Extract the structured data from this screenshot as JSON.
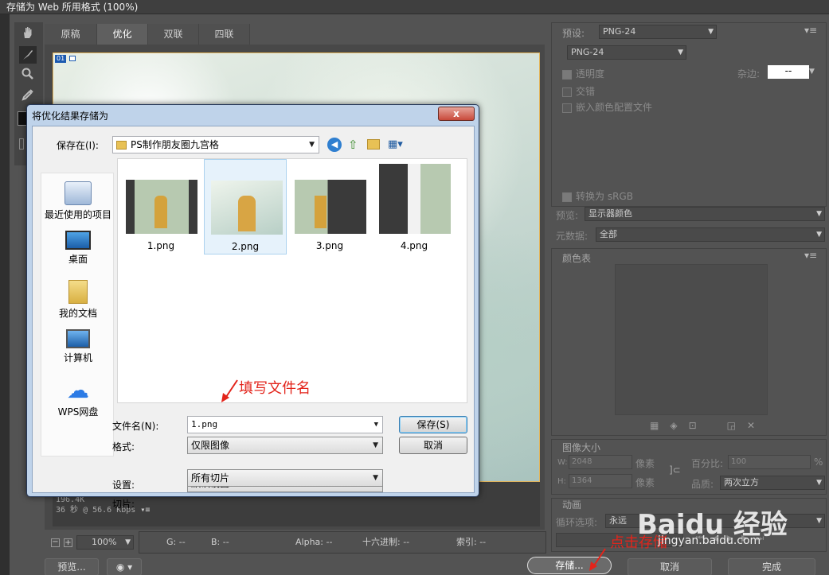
{
  "window": {
    "title": "存储为 Web 所用格式 (100%)"
  },
  "tabs": [
    {
      "label": "原稿"
    },
    {
      "label": "优化"
    },
    {
      "label": "双联"
    },
    {
      "label": "四联"
    }
  ],
  "canvas": {
    "tag": "01"
  },
  "info": {
    "size": "196.4K",
    "time": "36 秒 @ 56.6 Kbps"
  },
  "status": {
    "zoom": "100%",
    "g": "G: --",
    "b": "B: --",
    "alpha": "Alpha: --",
    "hex": "十六进制: --",
    "index": "索引: --"
  },
  "bottom": {
    "preview": "预览...",
    "save": "存储...",
    "cancel": "取消",
    "done": "完成"
  },
  "right": {
    "preset_label": "预设:",
    "preset_value": "PNG-24",
    "format_value": "PNG-24",
    "transparency": "透明度",
    "matte_label": "杂边:",
    "matte_value": "--",
    "interlaced": "交错",
    "embed_profile": "嵌入颜色配置文件",
    "convert_srgb": "转换为 sRGB",
    "preview_label": "预览:",
    "preview_value": "显示器颜色",
    "metadata_label": "元数据:",
    "metadata_value": "全部",
    "color_table": "颜色表",
    "image_size": "图像大小",
    "w_label": "W:",
    "w_value": "2048",
    "h_label": "H:",
    "h_value": "1364",
    "pixels": "像素",
    "percent_label": "百分比:",
    "percent_value": "100",
    "percent_unit": "%",
    "quality_label": "品质:",
    "quality_value": "两次立方",
    "animation": "动画",
    "loop_label": "循环选项:",
    "loop_value": "永远"
  },
  "dialog": {
    "title": "将优化结果存储为",
    "close": "x",
    "save_in_label": "保存在(I):",
    "folder": "PS制作朋友圈九宫格",
    "places": [
      {
        "label": "最近使用的项目"
      },
      {
        "label": "桌面"
      },
      {
        "label": "我的文档"
      },
      {
        "label": "计算机"
      },
      {
        "label": "WPS网盘"
      }
    ],
    "files": [
      {
        "name": "1.png"
      },
      {
        "name": "2.png"
      },
      {
        "name": "3.png"
      },
      {
        "name": "4.png"
      }
    ],
    "filename_label": "文件名(N):",
    "filename_value": "1.png",
    "format_label": "格式:",
    "format_value": "仅限图像",
    "settings_label": "设置:",
    "settings_value": "默认设置",
    "slices_label": "切片:",
    "slices_value": "所有切片",
    "save_button": "保存(S)",
    "cancel_button": "取消"
  },
  "annotations": {
    "fill_name": "填写文件名",
    "click_save": "点击存储"
  },
  "watermark": {
    "brand": "Baidu 经验",
    "url": "jingyan.baidu.com"
  }
}
